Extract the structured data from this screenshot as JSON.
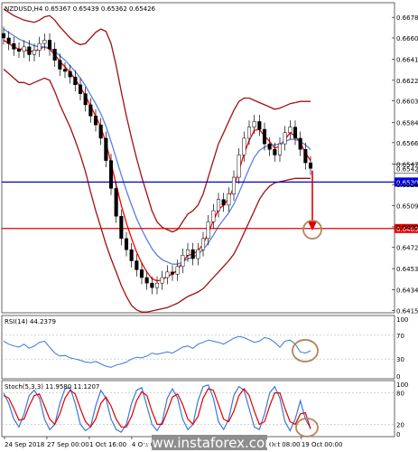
{
  "header": "NZDUSD,H4  0.65367 0.65439 0.65362 0.65426",
  "watermark": "www.instaforex.com",
  "chart_data": [
    {
      "type": "line",
      "name": "price",
      "title": "NZDUSD,H4  0.65367 0.65439 0.65362 0.65426",
      "symbol": "NZDUSD",
      "timeframe": "H4",
      "ohlc_last": {
        "open": 0.65367,
        "high": 0.65439,
        "low": 0.65362,
        "close": 0.65426
      },
      "ylim": [
        0.6415,
        0.669
      ],
      "y_ticks": [
        "0.66975",
        "0.66785",
        "0.66600",
        "0.66410",
        "0.66220",
        "0.66035",
        "0.65840",
        "0.65660",
        "0.65470",
        "0.65285",
        "0.65095",
        "0.64905",
        "0.64720",
        "0.64530",
        "0.64340",
        "0.64155"
      ],
      "x_ticks": [
        "24 Sep 2018",
        "27 Sep 00:00",
        "1 Oct 16:00",
        "4 Oct 08:00",
        "9 Oct 00:00",
        "11 Oct 16:00",
        "16 Oct 08:00",
        "19 Oct 00:00"
      ],
      "close_series": [
        0.666,
        0.6655,
        0.665,
        0.6648,
        0.6652,
        0.6645,
        0.6649,
        0.6655,
        0.6658,
        0.665,
        0.664,
        0.6632,
        0.663,
        0.6625,
        0.6618,
        0.661,
        0.66,
        0.659,
        0.6582,
        0.657,
        0.655,
        0.6525,
        0.65,
        0.648,
        0.647,
        0.646,
        0.6452,
        0.6445,
        0.644,
        0.6436,
        0.644,
        0.6445,
        0.645,
        0.6448,
        0.6455,
        0.6465,
        0.647,
        0.6462,
        0.647,
        0.648,
        0.6495,
        0.6505,
        0.6515,
        0.651,
        0.652,
        0.6535,
        0.6555,
        0.657,
        0.658,
        0.6585,
        0.6578,
        0.6565,
        0.656,
        0.6555,
        0.6565,
        0.6575,
        0.658,
        0.657,
        0.656,
        0.6548,
        0.6543
      ],
      "series": [
        {
          "name": "moving average (red)",
          "color": "#ff0000",
          "values": [
            0.6658,
            0.6655,
            0.6652,
            0.665,
            0.665,
            0.6648,
            0.6648,
            0.665,
            0.6652,
            0.665,
            0.6645,
            0.6639,
            0.6634,
            0.6629,
            0.6623,
            0.6616,
            0.6608,
            0.6599,
            0.659,
            0.658,
            0.6566,
            0.6548,
            0.6528,
            0.651,
            0.6494,
            0.648,
            0.6468,
            0.6458,
            0.645,
            0.6444,
            0.6442,
            0.6443,
            0.6446,
            0.6448,
            0.6452,
            0.6459,
            0.6465,
            0.6466,
            0.6469,
            0.6475,
            0.6485,
            0.6496,
            0.6506,
            0.651,
            0.6516,
            0.6526,
            0.6541,
            0.6556,
            0.6568,
            0.6577,
            0.6578,
            0.6572,
            0.6567,
            0.6561,
            0.6563,
            0.6569,
            0.6575,
            0.6572,
            0.6566,
            0.6557,
            0.655
          ]
        },
        {
          "name": "moving average (blue)",
          "color": "#5a7fe0",
          "values": [
            0.6668,
            0.6665,
            0.6662,
            0.6659,
            0.6657,
            0.6655,
            0.6653,
            0.6652,
            0.6652,
            0.6651,
            0.6648,
            0.6644,
            0.664,
            0.6635,
            0.663,
            0.6624,
            0.6617,
            0.6609,
            0.6601,
            0.6592,
            0.6581,
            0.6567,
            0.6552,
            0.6537,
            0.6523,
            0.651,
            0.6498,
            0.6488,
            0.6479,
            0.6471,
            0.6465,
            0.6461,
            0.6459,
            0.6457,
            0.6457,
            0.6459,
            0.6462,
            0.6463,
            0.6466,
            0.647,
            0.6476,
            0.6483,
            0.6491,
            0.6497,
            0.6503,
            0.6511,
            0.6521,
            0.6532,
            0.6543,
            0.6553,
            0.6559,
            0.6562,
            0.6564,
            0.6564,
            0.6565,
            0.6567,
            0.6569,
            0.6569,
            0.6567,
            0.6564,
            0.656
          ]
        },
        {
          "name": "bollinger band upper",
          "color": "#a01010",
          "values": [
            0.6686,
            0.6683,
            0.668,
            0.6678,
            0.6676,
            0.6675,
            0.6674,
            0.6676,
            0.6679,
            0.668,
            0.6676,
            0.667,
            0.6665,
            0.666,
            0.6656,
            0.6654,
            0.6655,
            0.666,
            0.6665,
            0.6668,
            0.6666,
            0.6655,
            0.6635,
            0.6612,
            0.659,
            0.657,
            0.6552,
            0.6535,
            0.652,
            0.6505,
            0.6495,
            0.649,
            0.6488,
            0.6486,
            0.6488,
            0.6495,
            0.6502,
            0.6505,
            0.651,
            0.652,
            0.6535,
            0.655,
            0.6565,
            0.6575,
            0.6585,
            0.6595,
            0.6603,
            0.6606,
            0.6606,
            0.6604,
            0.6602,
            0.66,
            0.6598,
            0.6596,
            0.6597,
            0.6599,
            0.6601,
            0.6602,
            0.6603,
            0.6603,
            0.6603
          ]
        },
        {
          "name": "bollinger band lower",
          "color": "#a01010",
          "values": [
            0.6632,
            0.6628,
            0.6624,
            0.662,
            0.662,
            0.6618,
            0.662,
            0.6622,
            0.6624,
            0.6622,
            0.6612,
            0.66,
            0.659,
            0.658,
            0.6568,
            0.6555,
            0.654,
            0.6522,
            0.6505,
            0.649,
            0.6475,
            0.6462,
            0.645,
            0.6438,
            0.6428,
            0.642,
            0.6416,
            0.6414,
            0.6414,
            0.6415,
            0.6416,
            0.6417,
            0.6418,
            0.642,
            0.6422,
            0.6425,
            0.6428,
            0.643,
            0.6432,
            0.6435,
            0.644,
            0.6445,
            0.645,
            0.6455,
            0.646,
            0.6466,
            0.6475,
            0.6485,
            0.6495,
            0.6505,
            0.6515,
            0.6522,
            0.6527,
            0.653,
            0.6531,
            0.6532,
            0.6533,
            0.6534,
            0.6534,
            0.6534,
            0.6534
          ]
        }
      ],
      "h_lines": [
        {
          "value": 0.65307,
          "label": "0.65307",
          "color": "#0000dd"
        },
        {
          "value": 0.6489,
          "label": "0.64890",
          "color": "#e00000"
        }
      ],
      "current_price_label": "0.65426",
      "arrow": {
        "from": 0.6541,
        "to": 0.6488,
        "color": "#e00000"
      },
      "circle_color": "#b5835a"
    },
    {
      "type": "line",
      "name": "rsi",
      "title": "RSI(14) 44.2379",
      "ylim": [
        0,
        100
      ],
      "y_ticks": [
        "100",
        "70",
        "30",
        "0"
      ],
      "series": [
        {
          "name": "RSI(14)",
          "color": "#3a78d8",
          "values": [
            60,
            55,
            52,
            50,
            55,
            48,
            52,
            58,
            60,
            50,
            40,
            35,
            36,
            32,
            30,
            28,
            25,
            24,
            26,
            22,
            18,
            16,
            20,
            22,
            25,
            30,
            33,
            32,
            35,
            40,
            38,
            40,
            42,
            40,
            45,
            50,
            52,
            48,
            55,
            58,
            62,
            60,
            58,
            55,
            60,
            65,
            68,
            66,
            62,
            58,
            60,
            66,
            64,
            58,
            50,
            60,
            62,
            55,
            42,
            40,
            44
          ]
        }
      ],
      "circle_color": "#b5835a"
    },
    {
      "type": "line",
      "name": "stochastic",
      "title": "Stoch(5,3,3) 11.9580 11.1207",
      "ylim": [
        0,
        100
      ],
      "y_ticks": [
        "100",
        "80",
        "20",
        "0"
      ],
      "series": [
        {
          "name": "%K",
          "color": "#3a78d8",
          "values": [
            80,
            60,
            30,
            15,
            40,
            75,
            85,
            70,
            30,
            10,
            20,
            60,
            88,
            90,
            60,
            20,
            8,
            15,
            55,
            85,
            70,
            30,
            10,
            5,
            20,
            60,
            85,
            90,
            55,
            20,
            8,
            25,
            70,
            88,
            70,
            30,
            10,
            20,
            65,
            92,
            95,
            70,
            25,
            10,
            30,
            75,
            92,
            85,
            50,
            15,
            10,
            40,
            80,
            92,
            70,
            25,
            8,
            30,
            65,
            30,
            12
          ]
        },
        {
          "name": "%D",
          "color": "#e00000",
          "values": [
            75,
            70,
            50,
            28,
            30,
            55,
            75,
            78,
            55,
            30,
            20,
            40,
            70,
            85,
            78,
            50,
            25,
            15,
            30,
            60,
            72,
            55,
            30,
            15,
            15,
            35,
            65,
            82,
            75,
            45,
            20,
            20,
            45,
            72,
            78,
            58,
            30,
            20,
            35,
            70,
            88,
            85,
            58,
            30,
            25,
            45,
            75,
            88,
            75,
            45,
            20,
            25,
            55,
            80,
            80,
            50,
            25,
            20,
            40,
            42,
            11
          ]
        }
      ],
      "circle_color": "#b5835a"
    }
  ]
}
